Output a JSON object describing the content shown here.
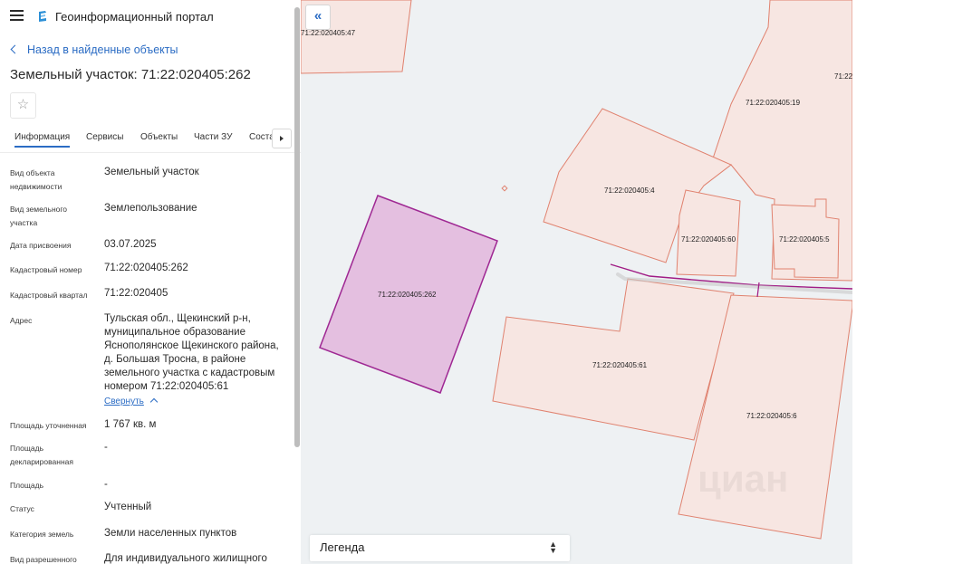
{
  "header": {
    "app_title": "Геоинформационный портал",
    "menu_icon": "hamburger-menu-icon",
    "logo_icon": "portal-logo-icon"
  },
  "nav": {
    "back_label": "Назад в найденные объекты"
  },
  "object": {
    "title": "Земельный участок: 71:22:020405:262"
  },
  "tabs": [
    {
      "label": "Информация",
      "active": true
    },
    {
      "label": "Сервисы"
    },
    {
      "label": "Объекты"
    },
    {
      "label": "Части ЗУ"
    },
    {
      "label": "Соста"
    }
  ],
  "fields": [
    {
      "label": "Вид объекта недвижимости",
      "value": "Земельный участок"
    },
    {
      "label": "Вид земельного участка",
      "value": "Землепользование"
    },
    {
      "label": "Дата присвоения",
      "value": "03.07.2025"
    },
    {
      "label": "Кадастровый номер",
      "value": "71:22:020405:262"
    },
    {
      "label": "Кадастровый квартал",
      "value": "71:22:020405"
    },
    {
      "label": "Адрес",
      "value": "Тульская обл., Щекинский р-н, муниципальное образование Яснополянское Щекинского района, д. Большая Тросна, в районе земельного участка с кадастровым номером 71:22:020405:61"
    },
    {
      "label": "Площадь уточненная",
      "value": "1 767 кв. м"
    },
    {
      "label": "Площадь декларированная",
      "value": "-"
    },
    {
      "label": "Площадь",
      "value": "-"
    },
    {
      "label": "Статус",
      "value": "Учтенный"
    },
    {
      "label": "Категория земель",
      "value": "Земли населенных пунктов"
    },
    {
      "label": "Вид разрешенного",
      "value": "Для индивидуального жилищного"
    }
  ],
  "collapse_label": "Свернуть",
  "map": {
    "legend_label": "Легенда",
    "watermark": "циан",
    "colors": {
      "parcel_fill": "#f7e6e2",
      "parcel_stroke": "#e0826f",
      "selected_fill": "#e4bde0",
      "selected_stroke": "#9b1e8e",
      "road": "#a01c85",
      "background": "#eef1f3"
    },
    "parcels": [
      {
        "label": "71:22:020405:47"
      },
      {
        "label": "71:22:020405:19"
      },
      {
        "label": "71:22"
      },
      {
        "label": "71:22:020405:4"
      },
      {
        "label": "71:22:020405:60"
      },
      {
        "label": "71:22:020405:5"
      },
      {
        "label": "71:22:020405:262"
      },
      {
        "label": "71:22:020405:61"
      },
      {
        "label": "71:22:020405:6"
      }
    ]
  }
}
